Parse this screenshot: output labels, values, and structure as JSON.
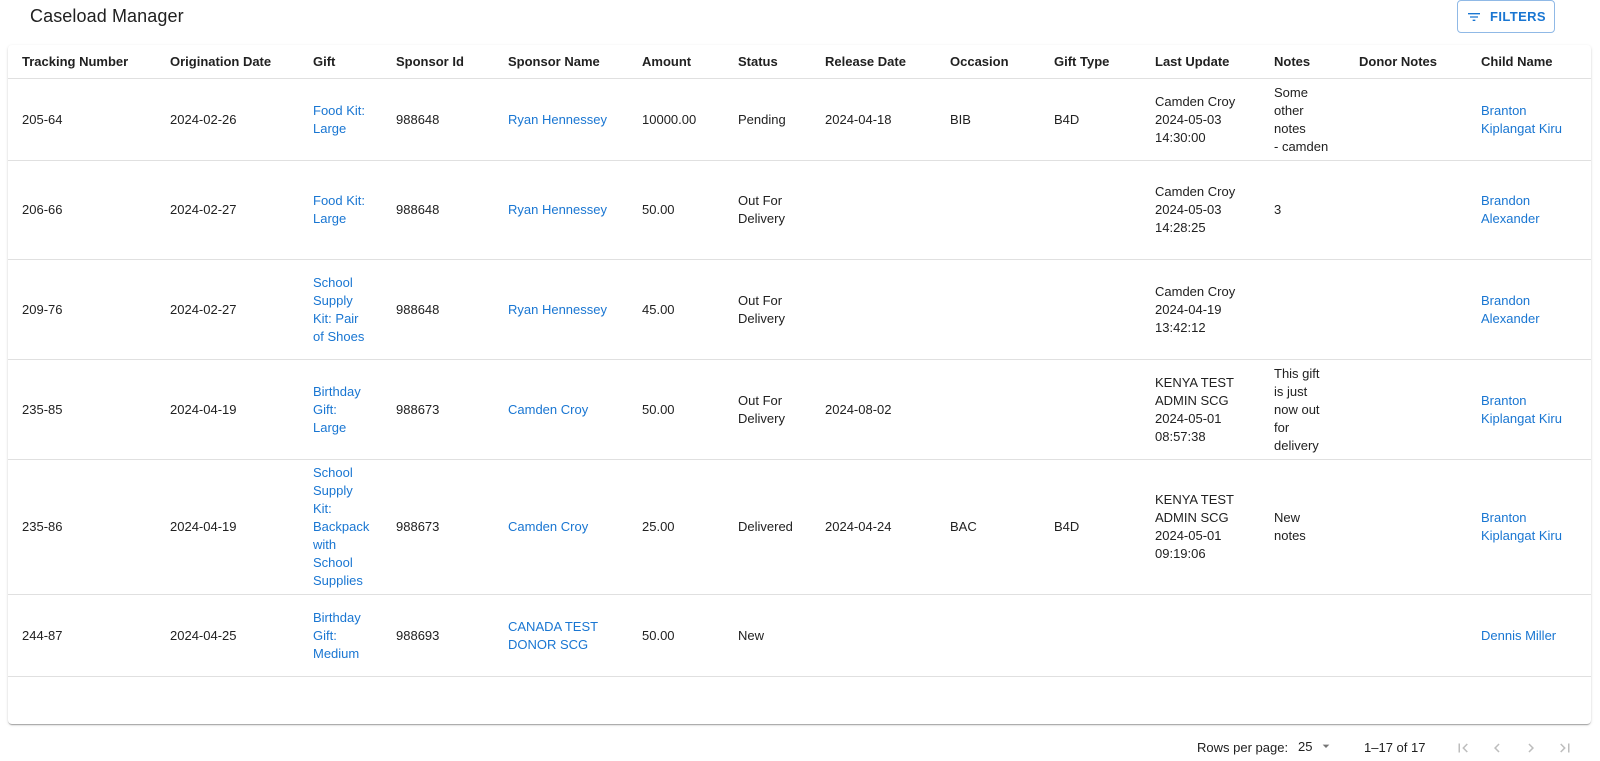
{
  "page": {
    "title": "Caseload Manager"
  },
  "toolbar": {
    "filters_label": "FILTERS"
  },
  "table": {
    "columns": [
      "Tracking Number",
      "Origination Date",
      "Gift",
      "Sponsor Id",
      "Sponsor Name",
      "Amount",
      "Status",
      "Release Date",
      "Occasion",
      "Gift Type",
      "Last Update",
      "Notes",
      "Donor Notes",
      "Child Name"
    ],
    "rows": [
      [
        "205-64",
        "2024-02-26",
        "Food Kit:\nLarge",
        "988648",
        "Ryan Hennessey",
        "10000.00",
        "Pending",
        "2024-04-18",
        "BIB",
        "B4D",
        "Camden Croy\n2024-05-03\n14:30:00",
        "Some\nother\nnotes\n- camden",
        "",
        "Branton\nKiplangat Kiru"
      ],
      [
        "206-66",
        "2024-02-27",
        "Food Kit:\nLarge",
        "988648",
        "Ryan Hennessey",
        "50.00",
        "Out For\nDelivery",
        "",
        "",
        "",
        "Camden Croy\n2024-05-03\n14:28:25",
        "3",
        "",
        "Brandon\nAlexander"
      ],
      [
        "209-76",
        "2024-02-27",
        "School\nSupply\nKit: Pair\nof Shoes",
        "988648",
        "Ryan Hennessey",
        "45.00",
        "Out For\nDelivery",
        "",
        "",
        "",
        "Camden Croy\n2024-04-19\n13:42:12",
        "",
        "",
        "Brandon\nAlexander"
      ],
      [
        "235-85",
        "2024-04-19",
        "Birthday\nGift:\nLarge",
        "988673",
        "Camden Croy",
        "50.00",
        "Out For\nDelivery",
        "2024-08-02",
        "",
        "",
        "KENYA TEST\nADMIN SCG\n2024-05-01\n08:57:38",
        "This gift\nis just\nnow out\nfor\ndelivery",
        "",
        "Branton\nKiplangat Kiru"
      ],
      [
        "235-86",
        "2024-04-19",
        "School\nSupply\nKit:\nBackpack\nwith\nSchool\nSupplies",
        "988673",
        "Camden Croy",
        "25.00",
        "Delivered",
        "2024-04-24",
        "BAC",
        "B4D",
        "KENYA TEST\nADMIN SCG\n2024-05-01\n09:19:06",
        "New\nnotes",
        "",
        "Branton\nKiplangat Kiru"
      ],
      [
        "244-87",
        "2024-04-25",
        "Birthday\nGift:\nMedium",
        "988693",
        "CANADA TEST\nDONOR SCG",
        "50.00",
        "New",
        "",
        "",
        "",
        "",
        "",
        "",
        "Dennis Miller"
      ]
    ]
  },
  "pagination": {
    "rows_per_page_label": "Rows per page:",
    "rows_per_page_value": "25",
    "range_text": "1–17 of 17"
  },
  "icons": {
    "filter": "filter-list-icon",
    "dropdown": "arrow-drop-down-icon",
    "first_page": "first-page-icon",
    "prev_page": "chevron-left-icon",
    "next_page": "chevron-right-icon",
    "last_page": "last-page-icon"
  },
  "colors": {
    "accent": "#1976d2",
    "divider": "#e0e0e0",
    "disabled": "#bdbdbd"
  }
}
